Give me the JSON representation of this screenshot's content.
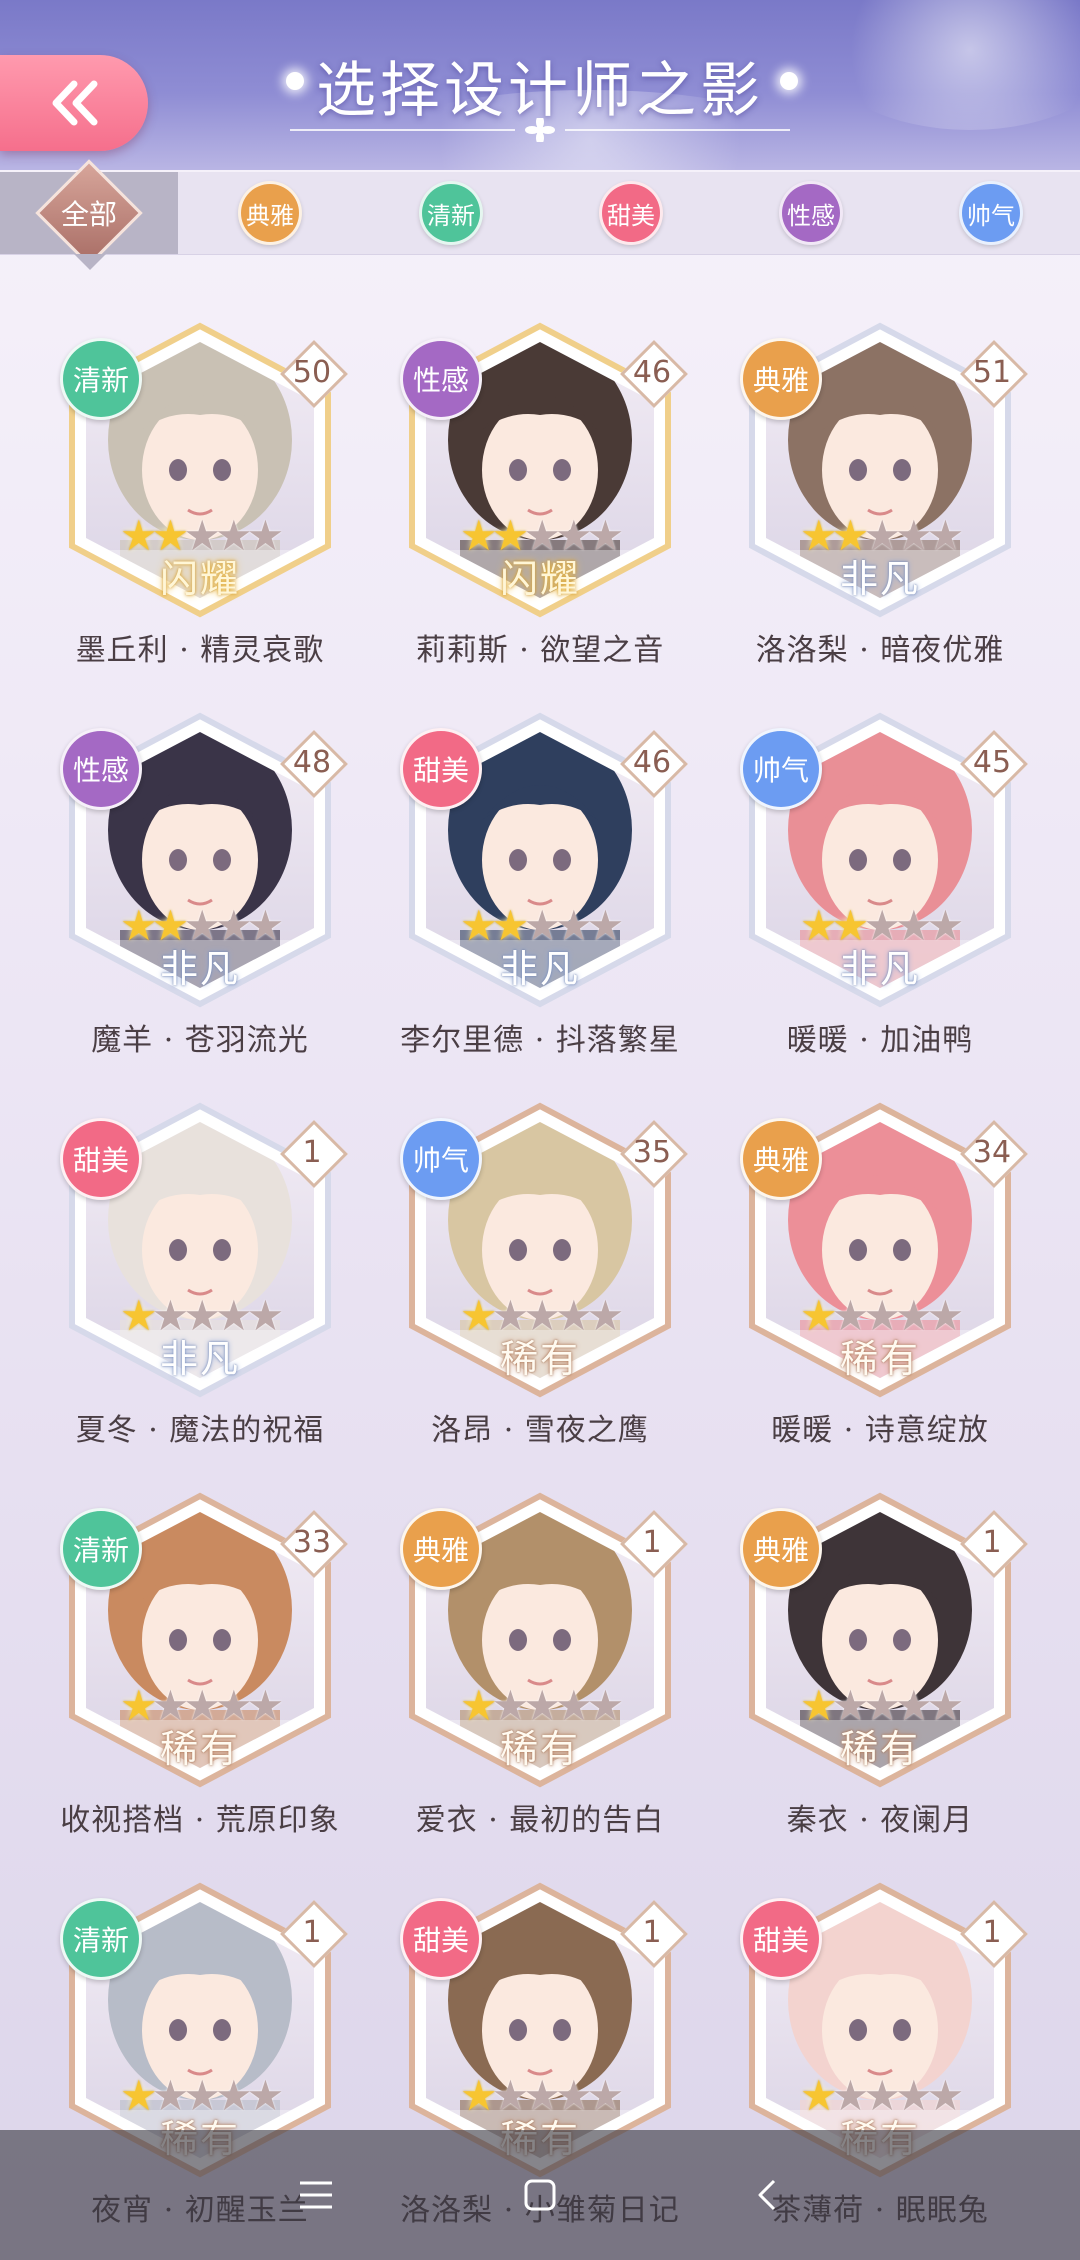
{
  "header": {
    "title": "选择设计师之影",
    "back_icon": "double-chevron-left-icon",
    "back_color": "#f56f8c"
  },
  "filters": {
    "all_label": "全部",
    "items": [
      {
        "label": "典雅",
        "color": "#e9a04c"
      },
      {
        "label": "清新",
        "color": "#4fc49a"
      },
      {
        "label": "甜美",
        "color": "#f26a86"
      },
      {
        "label": "性感",
        "color": "#a469c4"
      },
      {
        "label": "帅气",
        "color": "#6c9cf2"
      }
    ]
  },
  "colors": {
    "典雅": "#e9a04c",
    "清新": "#4fc49a",
    "甜美": "#f26a86",
    "性感": "#a469c4",
    "帅气": "#6c9cf2"
  },
  "cards": [
    {
      "name": "墨丘利 · 精灵哀歌",
      "style": "清新",
      "level": "50",
      "stars": 2,
      "rarity": "闪耀",
      "tone": "gold",
      "hair": "#c9c1b4"
    },
    {
      "name": "莉莉斯 · 欲望之音",
      "style": "性感",
      "level": "46",
      "stars": 2,
      "rarity": "闪耀",
      "tone": "gold",
      "hair": "#4a3a36"
    },
    {
      "name": "洛洛梨 · 暗夜优雅",
      "style": "典雅",
      "level": "51",
      "stars": 2,
      "rarity": "非凡",
      "tone": "silver",
      "hair": "#8c7264"
    },
    {
      "name": "魔羊 · 苍羽流光",
      "style": "性感",
      "level": "48",
      "stars": 2,
      "rarity": "非凡",
      "tone": "silver",
      "hair": "#3a3448"
    },
    {
      "name": "李尔里德 · 抖落繁星",
      "style": "甜美",
      "level": "46",
      "stars": 2,
      "rarity": "非凡",
      "tone": "silver",
      "hair": "#2f3f5e"
    },
    {
      "name": "暖暖 · 加油鸭",
      "style": "帅气",
      "level": "45",
      "stars": 2,
      "rarity": "非凡",
      "tone": "silver",
      "hair": "#e98f96"
    },
    {
      "name": "夏冬 · 魔法的祝福",
      "style": "甜美",
      "level": "1",
      "stars": 1,
      "rarity": "非凡",
      "tone": "silver",
      "hair": "#e8e1dc"
    },
    {
      "name": "洛昂 · 雪夜之鹰",
      "style": "帅气",
      "level": "35",
      "stars": 1,
      "rarity": "稀有",
      "tone": "bronze",
      "hair": "#d8c6a2"
    },
    {
      "name": "暖暖 · 诗意绽放",
      "style": "典雅",
      "level": "34",
      "stars": 1,
      "rarity": "稀有",
      "tone": "bronze",
      "hair": "#ec8f98"
    },
    {
      "name": "收视搭档 · 荒原印象",
      "style": "清新",
      "level": "33",
      "stars": 1,
      "rarity": "稀有",
      "tone": "bronze",
      "hair": "#c98a60"
    },
    {
      "name": "爱衣 · 最初的告白",
      "style": "典雅",
      "level": "1",
      "stars": 1,
      "rarity": "稀有",
      "tone": "bronze",
      "hair": "#b2906a"
    },
    {
      "name": "秦衣 · 夜阑月",
      "style": "典雅",
      "level": "1",
      "stars": 1,
      "rarity": "稀有",
      "tone": "bronze",
      "hair": "#3e3438"
    },
    {
      "name": "夜宵 · 初醒玉兰",
      "style": "清新",
      "level": "1",
      "stars": 1,
      "rarity": "稀有",
      "tone": "bronze",
      "hair": "#b7bcc8"
    },
    {
      "name": "洛洛梨 · 小雏菊日记",
      "style": "甜美",
      "level": "1",
      "stars": 1,
      "rarity": "稀有",
      "tone": "bronze",
      "hair": "#8a6a52"
    },
    {
      "name": "茶薄荷 · 眠眠兔",
      "style": "甜美",
      "level": "1",
      "stars": 1,
      "rarity": "稀有",
      "tone": "bronze",
      "hair": "#f3d3cf"
    }
  ],
  "max_stars": 5,
  "navbar": {
    "menu_icon": "menu-icon",
    "home_icon": "home-square-icon",
    "back_icon": "back-chevron-icon"
  }
}
